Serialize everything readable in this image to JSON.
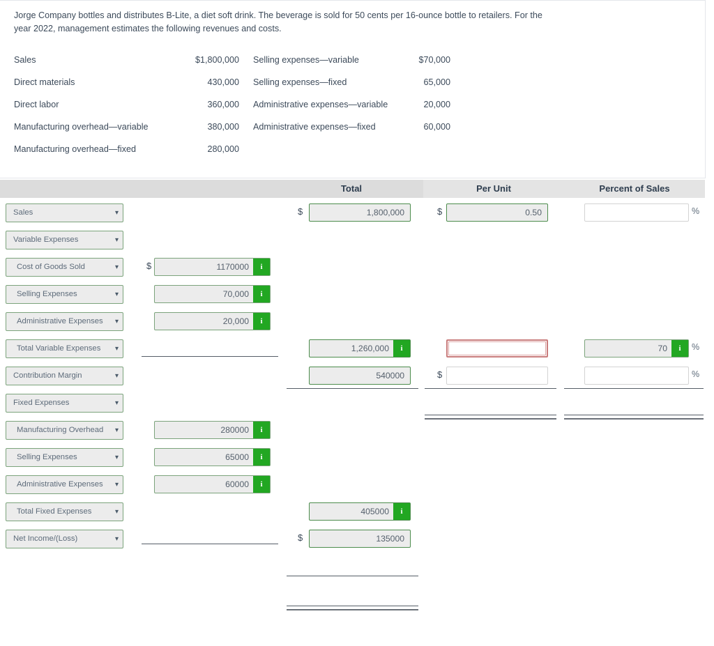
{
  "problem": {
    "intro": "Jorge Company bottles and distributes B-Lite, a diet soft drink. The beverage is sold for 50 cents per 16-ounce bottle to retailers. For the year 2022, management estimates the following revenues and costs.",
    "facts_left": [
      {
        "label": "Sales",
        "value": "$1,800,000"
      },
      {
        "label": "Direct materials",
        "value": "430,000"
      },
      {
        "label": "Direct labor",
        "value": "360,000"
      },
      {
        "label": "Manufacturing overhead—variable",
        "value": "380,000"
      },
      {
        "label": "Manufacturing overhead—fixed",
        "value": "280,000"
      }
    ],
    "facts_right": [
      {
        "label": "Selling expenses—variable",
        "value": "$70,000"
      },
      {
        "label": "Selling expenses—fixed",
        "value": "65,000"
      },
      {
        "label": "Administrative expenses—variable",
        "value": "20,000"
      },
      {
        "label": "Administrative expenses—fixed",
        "value": "60,000"
      },
      {
        "label": "",
        "value": ""
      }
    ]
  },
  "headers": {
    "total": "Total",
    "per_unit": "Per Unit",
    "percent_of_sales": "Percent of Sales"
  },
  "symbols": {
    "dollar": "$",
    "percent": "%",
    "info": "i",
    "chevron_down": "⌄"
  },
  "colors": {
    "accent_green": "#22a722",
    "field_border_green": "#7ba37b",
    "error_red": "#c97c7c",
    "header_band": "#e4e4e4",
    "header_total_band": "#dcdcdc",
    "field_fill": "#ececec"
  },
  "rows": [
    {
      "id": "sales",
      "select": "Sales",
      "indent": false,
      "col_a": null,
      "total": {
        "value": "1,800,000",
        "dollar": true,
        "info": false,
        "state": "filled"
      },
      "per_unit": {
        "value": "0.50",
        "dollar": true,
        "info": false,
        "state": "filled"
      },
      "percent": {
        "value": "",
        "info": false,
        "state": "blank",
        "suffix": "%"
      }
    },
    {
      "id": "variable-expenses",
      "select": "Variable Expenses",
      "indent": false,
      "col_a": null,
      "total": null,
      "per_unit": null,
      "percent": null
    },
    {
      "id": "cost-of-goods-sold",
      "select": "Cost of Goods Sold",
      "indent": true,
      "col_a": {
        "value": "1170000",
        "dollar": true,
        "info": true,
        "state": "filled"
      },
      "total": null,
      "per_unit": null,
      "percent": null
    },
    {
      "id": "selling-expenses-variable",
      "select": "Selling Expenses",
      "indent": true,
      "col_a": {
        "value": "70,000",
        "dollar": false,
        "info": true,
        "state": "filled"
      },
      "total": null,
      "per_unit": null,
      "percent": null
    },
    {
      "id": "administrative-expenses-variable",
      "select": "Administrative Expenses",
      "indent": true,
      "col_a": {
        "value": "20,000",
        "dollar": false,
        "info": true,
        "state": "filled"
      },
      "total": null,
      "per_unit": null,
      "percent": null
    },
    {
      "id": "total-variable-expenses",
      "select": "Total Variable Expenses",
      "indent": true,
      "col_a": null,
      "total": {
        "value": "1,260,000",
        "dollar": false,
        "info": true,
        "state": "filled"
      },
      "per_unit": {
        "value": "",
        "info": false,
        "state": "error"
      },
      "percent": {
        "value": "70",
        "info": true,
        "state": "filled",
        "suffix": "%"
      }
    },
    {
      "id": "contribution-margin",
      "select": "Contribution Margin",
      "indent": false,
      "col_a": null,
      "total": {
        "value": "540000",
        "dollar": false,
        "info": false,
        "state": "filled"
      },
      "per_unit": {
        "value": "",
        "dollar": true,
        "info": false,
        "state": "blank"
      },
      "percent": {
        "value": "",
        "info": false,
        "state": "blank",
        "suffix": "%"
      }
    },
    {
      "id": "fixed-expenses",
      "select": "Fixed Expenses",
      "indent": false,
      "col_a": null,
      "total": null,
      "per_unit": null,
      "percent": null
    },
    {
      "id": "manufacturing-overhead-fixed",
      "select": "Manufacturing Overhead",
      "indent": true,
      "col_a": {
        "value": "280000",
        "dollar": false,
        "info": true,
        "state": "filled"
      },
      "total": null,
      "per_unit": null,
      "percent": null
    },
    {
      "id": "selling-expenses-fixed",
      "select": "Selling Expenses",
      "indent": true,
      "col_a": {
        "value": "65000",
        "dollar": false,
        "info": true,
        "state": "filled"
      },
      "total": null,
      "per_unit": null,
      "percent": null
    },
    {
      "id": "administrative-expenses-fixed",
      "select": "Administrative Expenses",
      "indent": true,
      "col_a": {
        "value": "60000",
        "dollar": false,
        "info": true,
        "state": "filled"
      },
      "total": null,
      "per_unit": null,
      "percent": null
    },
    {
      "id": "total-fixed-expenses",
      "select": "Total Fixed Expenses",
      "indent": true,
      "col_a": null,
      "total": {
        "value": "405000",
        "dollar": false,
        "info": true,
        "state": "filled"
      },
      "per_unit": null,
      "percent": null
    },
    {
      "id": "net-income-loss",
      "select": "Net Income/(Loss)",
      "indent": false,
      "col_a": null,
      "total": {
        "value": "135000",
        "dollar": true,
        "info": false,
        "state": "filled"
      },
      "per_unit": null,
      "percent": null
    }
  ]
}
